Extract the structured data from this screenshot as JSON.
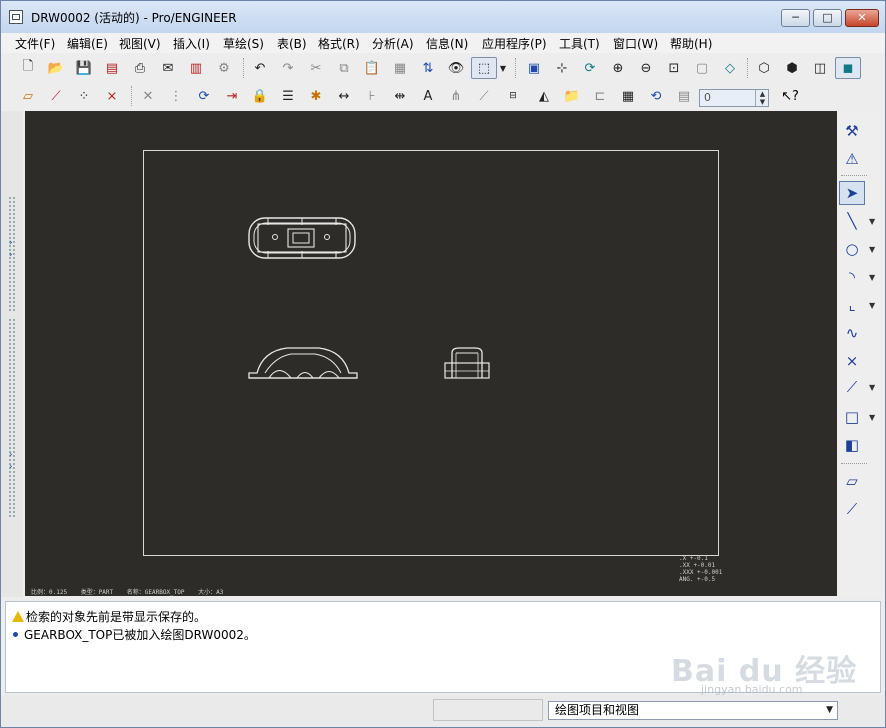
{
  "window": {
    "title": "DRW0002 (活动的) - Pro/ENGINEER",
    "min_glyph": "─",
    "max_glyph": "□",
    "close_glyph": "✕"
  },
  "menu": [
    {
      "label": "文件(F)"
    },
    {
      "label": "编辑(E)"
    },
    {
      "label": "视图(V)"
    },
    {
      "label": "插入(I)"
    },
    {
      "label": "草绘(S)"
    },
    {
      "label": "表(B)"
    },
    {
      "label": "格式(R)"
    },
    {
      "label": "分析(A)"
    },
    {
      "label": "信息(N)"
    },
    {
      "label": "应用程序(P)"
    },
    {
      "label": "工具(T)"
    },
    {
      "label": "窗口(W)"
    },
    {
      "label": "帮助(H)"
    }
  ],
  "toolbar": {
    "value_field": "0"
  },
  "canvas": {
    "tolerance_lines": [
      ".X    +-0.1",
      ".XX   +-0.01",
      ".XXX  +-0.001",
      "ANG.  +-0.5"
    ],
    "format_items": [
      "比例：0.125",
      "类型：PART",
      "名称：GEARBOX_TOP",
      "大小：A3"
    ]
  },
  "messages": {
    "line1": "检索的对象先前是带显示保存的。",
    "line2": "GEARBOX_TOP已被加入绘图DRW0002。"
  },
  "status": {
    "filter_value": "绘图项目和视图"
  },
  "watermark": {
    "text": "Bai du 经验",
    "sub": "jingyan.baidu.com"
  }
}
